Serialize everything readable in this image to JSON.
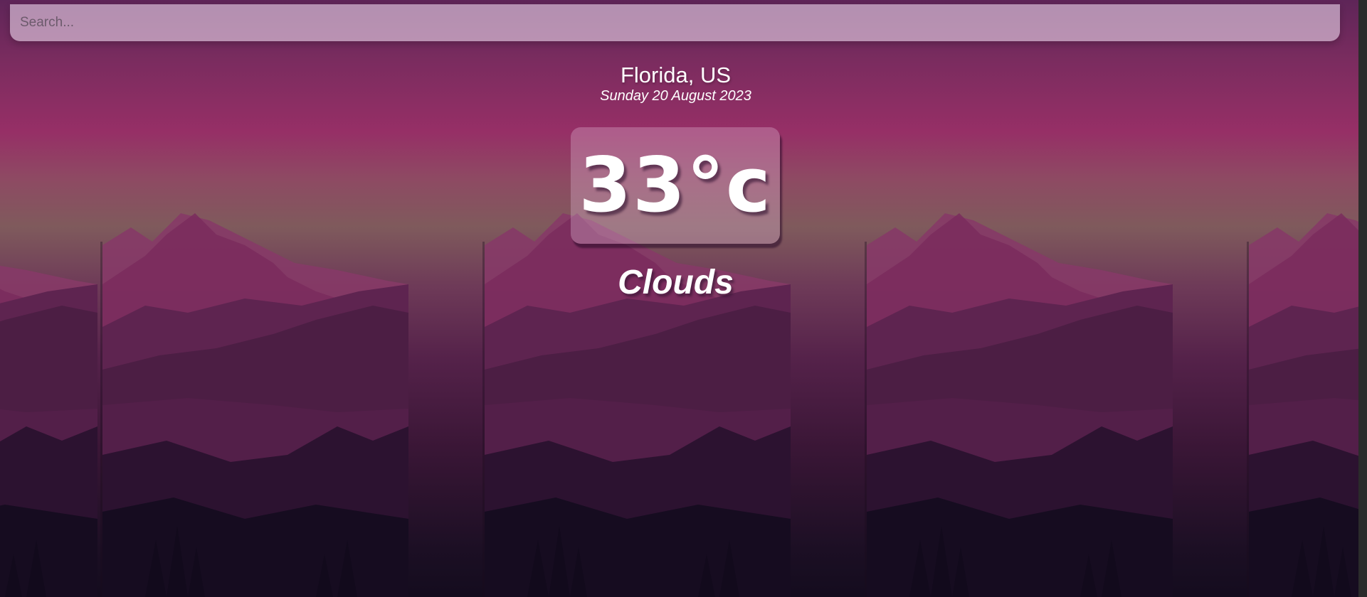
{
  "search": {
    "placeholder": "Search...",
    "value": ""
  },
  "weather": {
    "location": "Florida, US",
    "date": "Sunday 20 August 2023",
    "temperature": "33°c",
    "condition": "Clouds"
  },
  "colors": {
    "sky_top": "#5e2558",
    "sky_mid": "#962f66",
    "horizon": "#7f5a5c",
    "ground_dark": "#140c1e"
  }
}
